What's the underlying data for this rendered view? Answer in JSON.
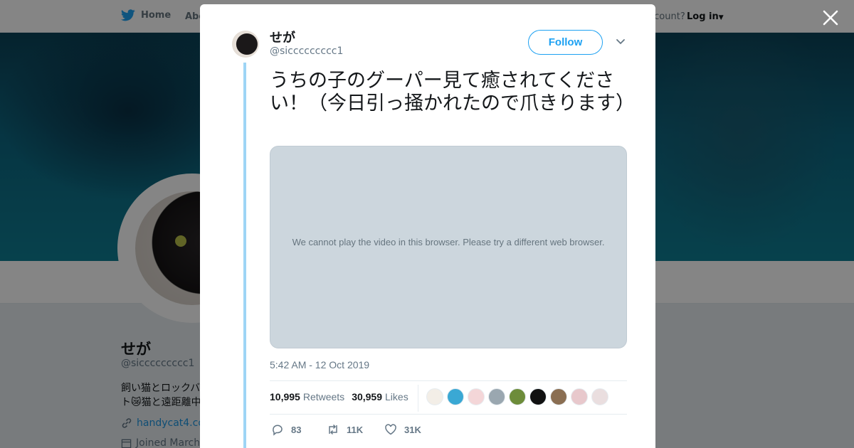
{
  "nav": {
    "home_label": "Home",
    "about_label": "Abo",
    "account_prompt": "ccount?",
    "login_label": "Log in"
  },
  "profile": {
    "name": "せが",
    "handle": "@siccccccccc1",
    "bio_line1": "飼い猫とロックバ",
    "bio_line2": "ト😿猫と遠距離中",
    "link": "handycat4.cor",
    "joined": "Joined March"
  },
  "tweet": {
    "author_name": "せが",
    "author_handle": "@siccccccccc1",
    "follow_label": "Follow",
    "text": "うちの子のグーパー見て癒されてください！（今日引っ掻かれたので爪きります）",
    "media_message": "We cannot play the video in this browser. Please try a different web browser.",
    "timestamp": "5:42 AM - 12 Oct 2019",
    "retweets_count": "10,995",
    "retweets_label": "Retweets",
    "likes_count": "30,959",
    "likes_label": "Likes",
    "replies_short": "83",
    "retweets_short": "11K",
    "likes_short": "31K",
    "liker_colors": [
      "#f3eee7",
      "#3aa8d4",
      "#f4d6d8",
      "#9aa7b0",
      "#6d8c3a",
      "#111111",
      "#8a6e52",
      "#e8c8cc",
      "#eadedf"
    ]
  },
  "colors": {
    "accent": "#1da1f2",
    "thread_line": "#9ed5f5"
  }
}
